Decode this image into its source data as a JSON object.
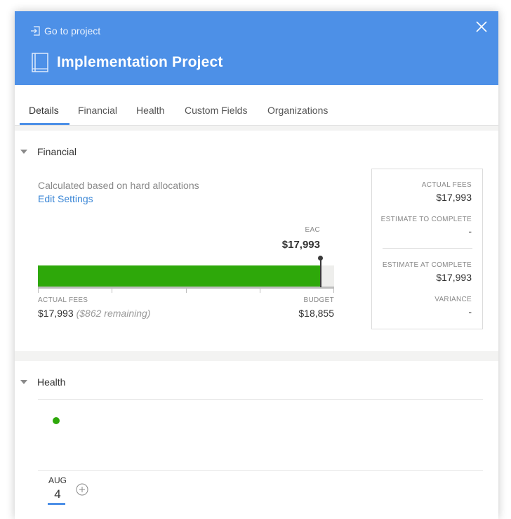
{
  "header": {
    "goto_label": "Go to project",
    "title": "Implementation Project",
    "close_icon": "close-icon",
    "book_icon": "book-icon",
    "goto_icon": "goto-project-icon"
  },
  "tabs": [
    {
      "label": "Details",
      "active": true
    },
    {
      "label": "Financial",
      "active": false
    },
    {
      "label": "Health",
      "active": false
    },
    {
      "label": "Custom Fields",
      "active": false
    },
    {
      "label": "Organizations",
      "active": false
    }
  ],
  "financial": {
    "section_title": "Financial",
    "calc_note": "Calculated based on hard allocations",
    "edit_settings": "Edit Settings",
    "eac_label": "EAC",
    "eac_value": "$17,993",
    "bar": {
      "actual_fees": 17993,
      "budget": 18855,
      "eac": 17993
    },
    "actual_fees_label": "ACTUAL FEES",
    "actual_fees_value": "$17,993",
    "remaining_text": "($862 remaining)",
    "budget_label": "BUDGET",
    "budget_value": "$18,855",
    "summary": {
      "actual_fees_label": "ACTUAL FEES",
      "actual_fees_value": "$17,993",
      "etc_label": "ESTIMATE TO COMPLETE",
      "etc_value": "-",
      "eac_label": "ESTIMATE AT COMPLETE",
      "eac_value": "$17,993",
      "variance_label": "VARIANCE",
      "variance_value": "-"
    }
  },
  "health": {
    "section_title": "Health",
    "status_color": "#2ea80a",
    "date_month": "AUG",
    "date_day": "4",
    "add_icon": "add-circle-icon"
  },
  "colors": {
    "header": "#4d90e7",
    "accent": "#4d90e7",
    "bar_fill": "#2ea80a",
    "link": "#3a86d6"
  }
}
